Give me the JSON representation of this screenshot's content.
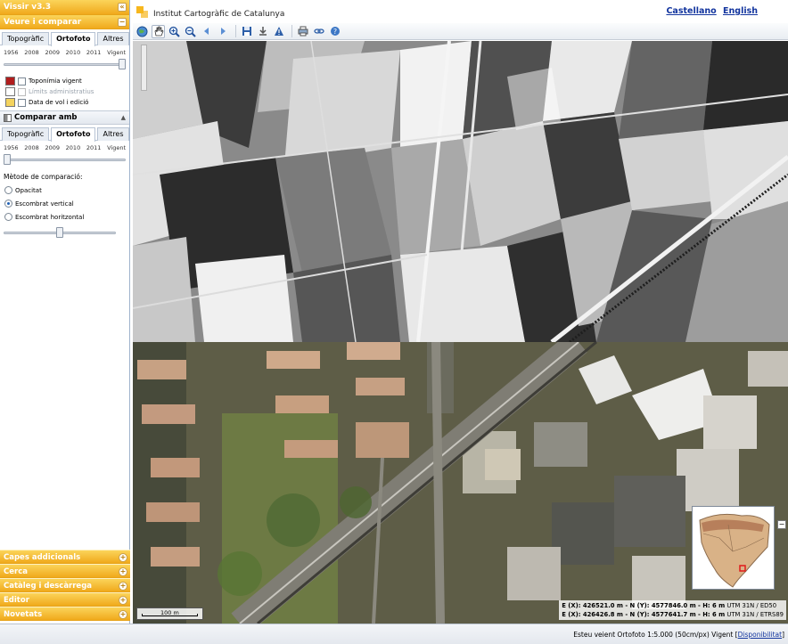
{
  "app": {
    "title": "Vissir v3.3",
    "collapse_glyph": "«"
  },
  "panel": {
    "section_title": "Veure i comparar",
    "section_ctl": "−",
    "tabs": [
      "Topogràfic",
      "Ortofoto",
      "Altres"
    ],
    "years": [
      "1956",
      "2008",
      "2009",
      "2010",
      "2011",
      "Vigent"
    ],
    "slider_value_fraction": 1.0,
    "layers": [
      {
        "label": "Toponímia vigent",
        "enabled": true
      },
      {
        "label": "Límits administratius",
        "enabled": false
      },
      {
        "label": "Data de vol i edició",
        "enabled": true
      }
    ],
    "compare_title": "Comparar amb",
    "compare_ctl": "▲",
    "compare_tabs": [
      "Topogràfic",
      "Ortofoto",
      "Altres"
    ],
    "compare_years": [
      "1956",
      "2008",
      "2009",
      "2010",
      "2011",
      "Vigent"
    ],
    "compare_slider_fraction": 0.0,
    "method_label": "Mètode de comparació:",
    "methods": [
      {
        "label": "Opacitat",
        "selected": false
      },
      {
        "label": "Escombrat vertical",
        "selected": true
      },
      {
        "label": "Escombrat horitzontal",
        "selected": false
      }
    ],
    "method_slider_fraction": 0.5
  },
  "bottom_sections": [
    {
      "label": "Capes addicionals",
      "ctl": "+"
    },
    {
      "label": "Cerca",
      "ctl": "+"
    },
    {
      "label": "Catàleg i descàrrega",
      "ctl": "+"
    },
    {
      "label": "Editor",
      "ctl": "+"
    },
    {
      "label": "Novetats",
      "ctl": "+"
    }
  ],
  "header": {
    "org": "Institut Cartogràfic de Catalunya",
    "lang_castellano": "Castellano",
    "lang_english": "English"
  },
  "toolbar_icons": [
    "globe-icon",
    "hand-pan-icon",
    "zoom-in-icon",
    "zoom-out-icon",
    "back-icon",
    "forward-icon",
    "save-icon",
    "download-icon",
    "warning-icon",
    "print-icon",
    "link-icon",
    "help-icon"
  ],
  "map": {
    "scale_label": "100 m",
    "coords": [
      {
        "prefix": "E (X): ",
        "x": "426521.0 m",
        "mid": " - N (Y): ",
        "y": "4577846.0 m",
        "h": " - H: 6 m",
        "sys": " UTM 31N / ED50"
      },
      {
        "prefix": "E (X): ",
        "x": "426426.8 m",
        "mid": " - N (Y): ",
        "y": "4577641.7 m",
        "h": " - H: 6 m",
        "sys": " UTM 31N / ETRS89"
      }
    ],
    "overview_toggle": "−"
  },
  "status": {
    "text": "Esteu veient Ortofoto 1:5.000 (50cm/px) Vigent [",
    "link": "Disponibilitat",
    "suffix": "]"
  }
}
